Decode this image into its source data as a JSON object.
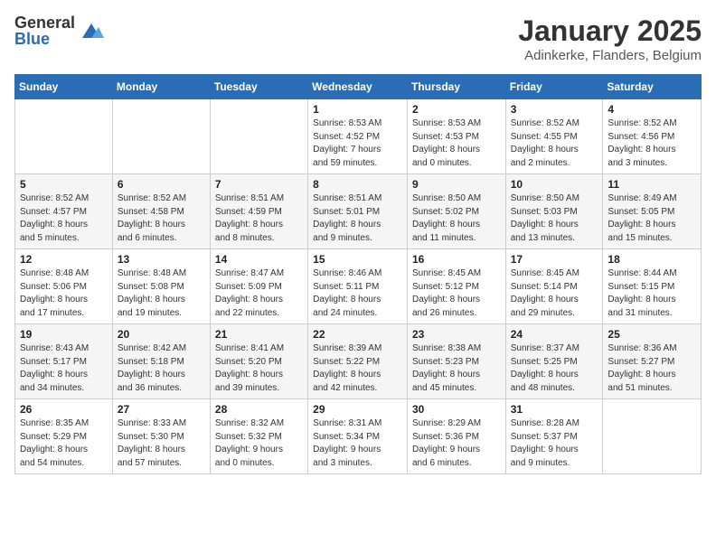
{
  "logo": {
    "general": "General",
    "blue": "Blue"
  },
  "title": "January 2025",
  "subtitle": "Adinkerke, Flanders, Belgium",
  "headers": [
    "Sunday",
    "Monday",
    "Tuesday",
    "Wednesday",
    "Thursday",
    "Friday",
    "Saturday"
  ],
  "weeks": [
    [
      {
        "day": "",
        "info": ""
      },
      {
        "day": "",
        "info": ""
      },
      {
        "day": "",
        "info": ""
      },
      {
        "day": "1",
        "info": "Sunrise: 8:53 AM\nSunset: 4:52 PM\nDaylight: 7 hours\nand 59 minutes."
      },
      {
        "day": "2",
        "info": "Sunrise: 8:53 AM\nSunset: 4:53 PM\nDaylight: 8 hours\nand 0 minutes."
      },
      {
        "day": "3",
        "info": "Sunrise: 8:52 AM\nSunset: 4:55 PM\nDaylight: 8 hours\nand 2 minutes."
      },
      {
        "day": "4",
        "info": "Sunrise: 8:52 AM\nSunset: 4:56 PM\nDaylight: 8 hours\nand 3 minutes."
      }
    ],
    [
      {
        "day": "5",
        "info": "Sunrise: 8:52 AM\nSunset: 4:57 PM\nDaylight: 8 hours\nand 5 minutes."
      },
      {
        "day": "6",
        "info": "Sunrise: 8:52 AM\nSunset: 4:58 PM\nDaylight: 8 hours\nand 6 minutes."
      },
      {
        "day": "7",
        "info": "Sunrise: 8:51 AM\nSunset: 4:59 PM\nDaylight: 8 hours\nand 8 minutes."
      },
      {
        "day": "8",
        "info": "Sunrise: 8:51 AM\nSunset: 5:01 PM\nDaylight: 8 hours\nand 9 minutes."
      },
      {
        "day": "9",
        "info": "Sunrise: 8:50 AM\nSunset: 5:02 PM\nDaylight: 8 hours\nand 11 minutes."
      },
      {
        "day": "10",
        "info": "Sunrise: 8:50 AM\nSunset: 5:03 PM\nDaylight: 8 hours\nand 13 minutes."
      },
      {
        "day": "11",
        "info": "Sunrise: 8:49 AM\nSunset: 5:05 PM\nDaylight: 8 hours\nand 15 minutes."
      }
    ],
    [
      {
        "day": "12",
        "info": "Sunrise: 8:48 AM\nSunset: 5:06 PM\nDaylight: 8 hours\nand 17 minutes."
      },
      {
        "day": "13",
        "info": "Sunrise: 8:48 AM\nSunset: 5:08 PM\nDaylight: 8 hours\nand 19 minutes."
      },
      {
        "day": "14",
        "info": "Sunrise: 8:47 AM\nSunset: 5:09 PM\nDaylight: 8 hours\nand 22 minutes."
      },
      {
        "day": "15",
        "info": "Sunrise: 8:46 AM\nSunset: 5:11 PM\nDaylight: 8 hours\nand 24 minutes."
      },
      {
        "day": "16",
        "info": "Sunrise: 8:45 AM\nSunset: 5:12 PM\nDaylight: 8 hours\nand 26 minutes."
      },
      {
        "day": "17",
        "info": "Sunrise: 8:45 AM\nSunset: 5:14 PM\nDaylight: 8 hours\nand 29 minutes."
      },
      {
        "day": "18",
        "info": "Sunrise: 8:44 AM\nSunset: 5:15 PM\nDaylight: 8 hours\nand 31 minutes."
      }
    ],
    [
      {
        "day": "19",
        "info": "Sunrise: 8:43 AM\nSunset: 5:17 PM\nDaylight: 8 hours\nand 34 minutes."
      },
      {
        "day": "20",
        "info": "Sunrise: 8:42 AM\nSunset: 5:18 PM\nDaylight: 8 hours\nand 36 minutes."
      },
      {
        "day": "21",
        "info": "Sunrise: 8:41 AM\nSunset: 5:20 PM\nDaylight: 8 hours\nand 39 minutes."
      },
      {
        "day": "22",
        "info": "Sunrise: 8:39 AM\nSunset: 5:22 PM\nDaylight: 8 hours\nand 42 minutes."
      },
      {
        "day": "23",
        "info": "Sunrise: 8:38 AM\nSunset: 5:23 PM\nDaylight: 8 hours\nand 45 minutes."
      },
      {
        "day": "24",
        "info": "Sunrise: 8:37 AM\nSunset: 5:25 PM\nDaylight: 8 hours\nand 48 minutes."
      },
      {
        "day": "25",
        "info": "Sunrise: 8:36 AM\nSunset: 5:27 PM\nDaylight: 8 hours\nand 51 minutes."
      }
    ],
    [
      {
        "day": "26",
        "info": "Sunrise: 8:35 AM\nSunset: 5:29 PM\nDaylight: 8 hours\nand 54 minutes."
      },
      {
        "day": "27",
        "info": "Sunrise: 8:33 AM\nSunset: 5:30 PM\nDaylight: 8 hours\nand 57 minutes."
      },
      {
        "day": "28",
        "info": "Sunrise: 8:32 AM\nSunset: 5:32 PM\nDaylight: 9 hours\nand 0 minutes."
      },
      {
        "day": "29",
        "info": "Sunrise: 8:31 AM\nSunset: 5:34 PM\nDaylight: 9 hours\nand 3 minutes."
      },
      {
        "day": "30",
        "info": "Sunrise: 8:29 AM\nSunset: 5:36 PM\nDaylight: 9 hours\nand 6 minutes."
      },
      {
        "day": "31",
        "info": "Sunrise: 8:28 AM\nSunset: 5:37 PM\nDaylight: 9 hours\nand 9 minutes."
      },
      {
        "day": "",
        "info": ""
      }
    ]
  ]
}
